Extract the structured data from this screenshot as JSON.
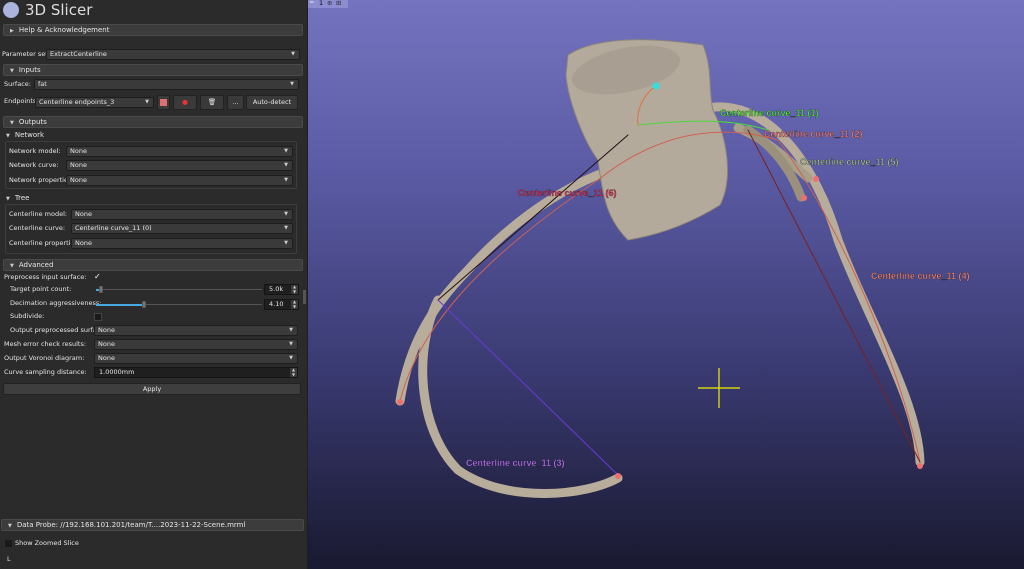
{
  "app": {
    "title": "3D Slicer"
  },
  "help": {
    "label": "Help & Acknowledgement"
  },
  "parameter_set": {
    "label": "Parameter set:",
    "value": "ExtractCenterline"
  },
  "inputs": {
    "header": "Inputs",
    "surface_label": "Surface:",
    "surface_value": "fat",
    "endpoints_label": "Endpoints:",
    "endpoints_value": "Centerline endpoints_3",
    "autodetect": "Auto-detect"
  },
  "outputs": {
    "header": "Outputs",
    "network": {
      "header": "Network",
      "rows": [
        {
          "label": "Network model:",
          "value": "None"
        },
        {
          "label": "Network curve:",
          "value": "None"
        },
        {
          "label": "Network properties:",
          "value": "None"
        }
      ]
    },
    "tree": {
      "header": "Tree",
      "rows": [
        {
          "label": "Centerline model:",
          "value": "None"
        },
        {
          "label": "Centerline curve:",
          "value": "Centerline curve_11 (0)"
        },
        {
          "label": "Centerline properties:",
          "value": "None"
        }
      ]
    }
  },
  "advanced": {
    "header": "Advanced",
    "preprocess_label": "Preprocess input surface:",
    "preprocess_checked": true,
    "target_label": "Target point count:",
    "target_value": "5.0k",
    "target_fraction": 0.02,
    "decimation_label": "Decimation aggressiveness:",
    "decimation_value": "4.10",
    "decimation_fraction": 0.28,
    "subdivide_label": "Subdivide:",
    "subdivide_checked": false,
    "output_pre_label": "Output preprocessed surface:",
    "output_pre_value": "None",
    "mesh_label": "Mesh error check results:",
    "mesh_value": "None",
    "voronoi_label": "Output Voronoi diagram:",
    "voronoi_value": "None",
    "sampling_label": "Curve sampling distance:",
    "sampling_value": "1.0000mm",
    "apply": "Apply"
  },
  "data_probe": {
    "header": "Data Probe: //192.168.101.201/team/T....2023-11-22-Scene.mrml",
    "show_zoomed": "Show Zoomed Slice",
    "l": "L"
  },
  "view": {
    "number": "1",
    "labels": [
      {
        "text": "Centerline curve_11 (1)",
        "color": "#4cff3c"
      },
      {
        "text": "Centerline curve_11 (2)",
        "color": "#ff8080"
      },
      {
        "text": "Centerline curve_11 (5)",
        "color": "#a8c8a0"
      },
      {
        "text": "Centerline curve_11 (6)",
        "color": "#e8305a"
      },
      {
        "text": "Centerline curve_11 (4)",
        "color": "#ff8a80"
      },
      {
        "text": "Centerline curve_11 (3)",
        "color": "#c070ff"
      }
    ]
  }
}
